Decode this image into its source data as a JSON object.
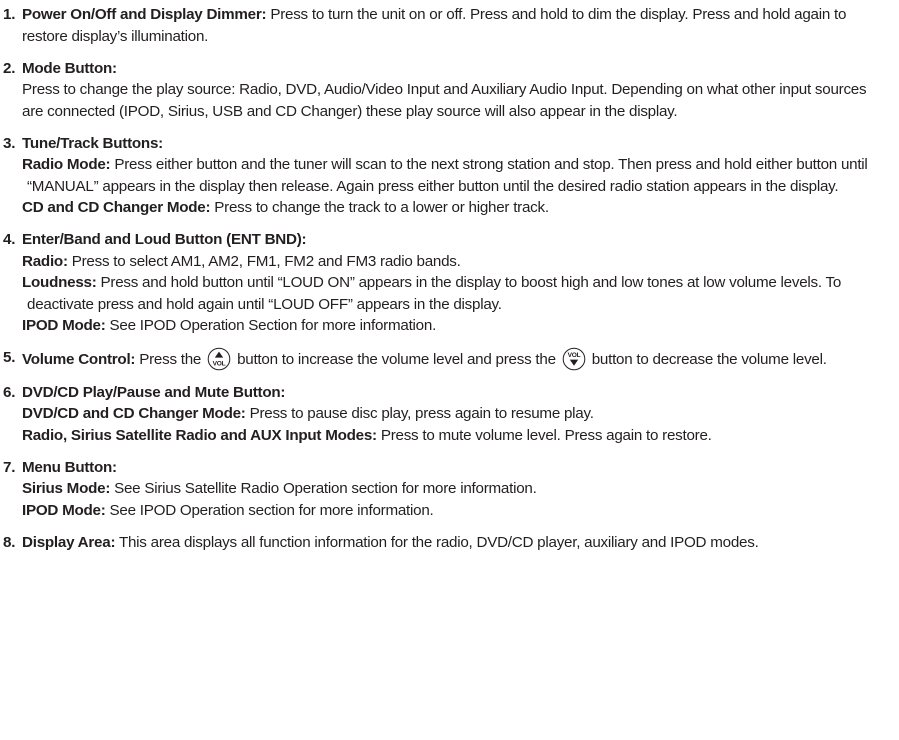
{
  "items": [
    {
      "number": "1.",
      "title": "Power On/Off and Display Dimmer:",
      "text": " Press to turn the unit on or off. Press and hold to dim the display. Press and hold again to restore display’s illumination."
    },
    {
      "number": "2.",
      "title": "Mode Button:",
      "text": "Press to change the play source: Radio, DVD, Audio/Video Input and Auxiliary Audio Input. Depending on what other input sources are connected (IPOD, Sirius, USB and CD Changer) these play source will also appear in the display."
    },
    {
      "number": "3.",
      "title": "Tune/Track Buttons:",
      "sub": [
        {
          "label": "Radio Mode:",
          "text": " Press either button and the tuner will scan to the next strong station and stop. Then press and hold either button until “MANUAL” appears in the display then release. Again press either button until the desired radio station appears in the display."
        },
        {
          "label": "CD and CD Changer Mode:",
          "text": " Press to change the track to a lower or higher track."
        }
      ]
    },
    {
      "number": "4.",
      "title": "Enter/Band and Loud Button (ENT BND):",
      "sub": [
        {
          "label": "Radio:",
          "text": " Press to select AM1, AM2, FM1, FM2 and FM3 radio bands."
        },
        {
          "label": "Loudness:",
          "text": " Press and hold button until “LOUD ON” appears in the display to boost high and low tones at low volume levels. To deactivate press and hold again until “LOUD OFF” appears in the display."
        },
        {
          "label": "IPOD Mode:",
          "text": " See IPOD Operation Section for more information."
        }
      ]
    },
    {
      "number": "5.",
      "title": "Volume Control:",
      "text_a": " Press the ",
      "text_b": " button to increase the volume level and press the ",
      "text_c": " button to decrease the volume level.",
      "vol_label": "VOL"
    },
    {
      "number": "6.",
      "title": "DVD/CD Play/Pause and Mute Button:",
      "sub": [
        {
          "label": "DVD/CD and CD Changer Mode:",
          "text": " Press to pause disc play, press again to resume play."
        },
        {
          "label": "Radio, Sirius Satellite Radio and AUX Input Modes:",
          "text": " Press to mute volume level. Press again to restore."
        }
      ]
    },
    {
      "number": "7.",
      "title": "Menu Button:",
      "sub": [
        {
          "label": "Sirius Mode:",
          "text": " See Sirius Satellite Radio Operation section for more information."
        },
        {
          "label": "IPOD Mode:",
          "text": " See IPOD Operation section for more information."
        }
      ]
    },
    {
      "number": "8.",
      "title": "Display Area:",
      "text": " This area displays all function information for the radio, DVD/CD player, auxiliary and IPOD modes."
    }
  ]
}
